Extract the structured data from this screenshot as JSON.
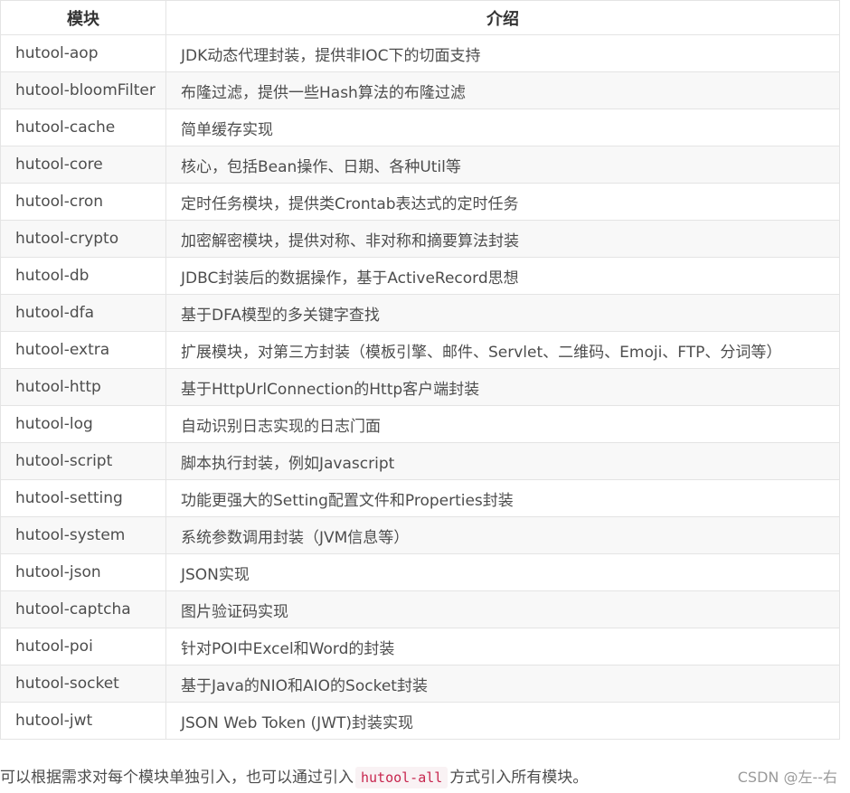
{
  "table": {
    "headers": [
      "模块",
      "介绍"
    ],
    "rows": [
      [
        "hutool-aop",
        "JDK动态代理封装，提供非IOC下的切面支持"
      ],
      [
        "hutool-bloomFilter",
        "布隆过滤，提供一些Hash算法的布隆过滤"
      ],
      [
        "hutool-cache",
        "简单缓存实现"
      ],
      [
        "hutool-core",
        "核心，包括Bean操作、日期、各种Util等"
      ],
      [
        "hutool-cron",
        "定时任务模块，提供类Crontab表达式的定时任务"
      ],
      [
        "hutool-crypto",
        "加密解密模块，提供对称、非对称和摘要算法封装"
      ],
      [
        "hutool-db",
        "JDBC封装后的数据操作，基于ActiveRecord思想"
      ],
      [
        "hutool-dfa",
        "基于DFA模型的多关键字查找"
      ],
      [
        "hutool-extra",
        "扩展模块，对第三方封装（模板引擎、邮件、Servlet、二维码、Emoji、FTP、分词等）"
      ],
      [
        "hutool-http",
        "基于HttpUrlConnection的Http客户端封装"
      ],
      [
        "hutool-log",
        "自动识别日志实现的日志门面"
      ],
      [
        "hutool-script",
        "脚本执行封装，例如Javascript"
      ],
      [
        "hutool-setting",
        "功能更强大的Setting配置文件和Properties封装"
      ],
      [
        "hutool-system",
        "系统参数调用封装（JVM信息等）"
      ],
      [
        "hutool-json",
        "JSON实现"
      ],
      [
        "hutool-captcha",
        "图片验证码实现"
      ],
      [
        "hutool-poi",
        "针对POI中Excel和Word的封装"
      ],
      [
        "hutool-socket",
        "基于Java的NIO和AIO的Socket封装"
      ],
      [
        "hutool-jwt",
        "JSON Web Token (JWT)封装实现"
      ]
    ]
  },
  "footer": {
    "text_before": "可以根据需求对每个模块单独引入，也可以通过引入",
    "code": "hutool-all",
    "text_after": "方式引入所有模块。"
  },
  "watermark": "CSDN @左--右",
  "colors": {
    "border": "#e4e4e4",
    "stripe": "#f8f8f8",
    "code_text": "#c7254e",
    "code_bg": "#f9f2f4"
  }
}
